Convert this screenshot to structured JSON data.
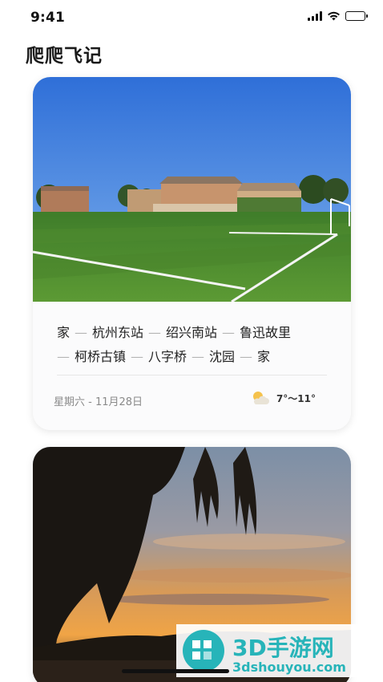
{
  "status_bar": {
    "time": "9:41"
  },
  "app": {
    "title": "爬爬飞记"
  },
  "cards": [
    {
      "route": [
        "家",
        "杭州东站",
        "绍兴南站",
        "鲁迅故里",
        "柯桥古镇",
        "八字桥",
        "沈园",
        "家"
      ],
      "date": "星期六 - 11月28日",
      "weather": {
        "icon": "partly-cloudy-icon",
        "temperature": "7°～11°"
      }
    }
  ],
  "watermark": {
    "brand": "3D手游网",
    "url": "3dshouyou.com"
  },
  "colors": {
    "accent_watermark": "#27b4b9",
    "text_primary": "#222222",
    "text_secondary": "#8a8a8a"
  }
}
